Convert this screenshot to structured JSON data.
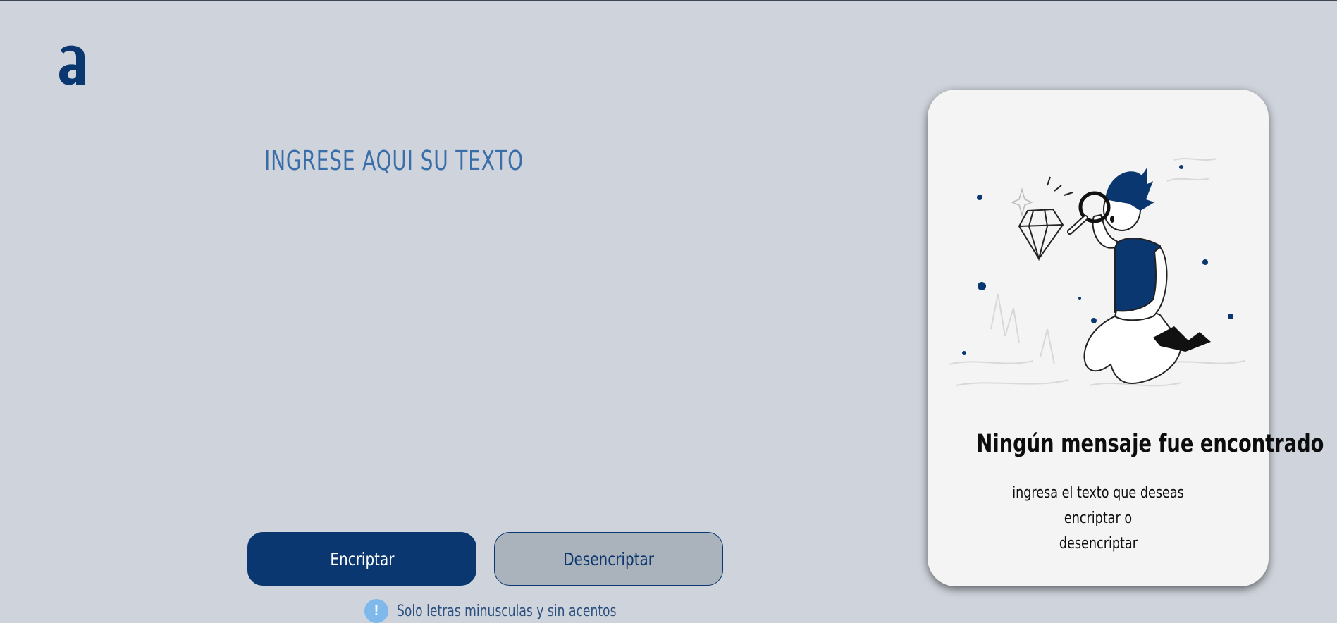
{
  "app": {
    "logo_letter": "a"
  },
  "main": {
    "input_title": "INGRESE AQUI SU TEXTO",
    "input_value": "",
    "encrypt_label": "Encriptar",
    "decrypt_label": "Desencriptar",
    "hint_icon": "!",
    "hint_text": "Solo letras minusculas y sin acentos"
  },
  "output": {
    "title": "Ningún mensaje fue encontrado",
    "message_line1": "ingresa el texto que deseas encriptar o",
    "message_line2": "desencriptar"
  },
  "colors": {
    "background": "#cfd4dc",
    "primary": "#0a376f",
    "title_blue": "#3a6ea8",
    "secondary_button": "#aab2bb",
    "card": "#f4f4f4",
    "info_icon": "#7fb8ea"
  },
  "icons": {
    "logo": "alura-a-logo-icon",
    "info": "info-icon",
    "illustration": "person-with-magnifier-illustration"
  }
}
